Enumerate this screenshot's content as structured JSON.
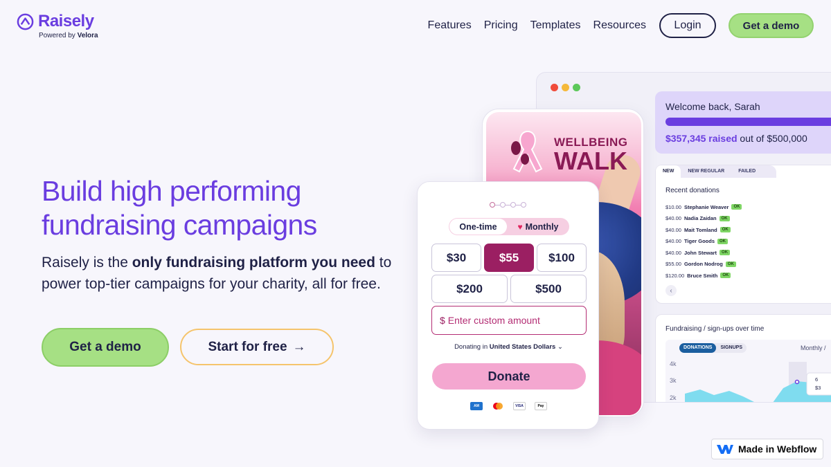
{
  "brand": {
    "name": "Raisely",
    "powered_prefix": "Powered by",
    "powered_by": "Velora",
    "color": "#6a3de0"
  },
  "nav": {
    "links": [
      "Features",
      "Pricing",
      "Templates",
      "Resources"
    ],
    "login": "Login",
    "demo": "Get a demo"
  },
  "hero": {
    "title": "Build high performing fundraising campaigns",
    "desc_pre": "Raisely is the ",
    "desc_bold": "only fundraising platform you need",
    "desc_post": " to power top-tier campaigns for your charity, all for free.",
    "cta_primary": "Get a demo",
    "cta_secondary": "Start for free",
    "cta_secondary_icon": "arrow-right-icon"
  },
  "dashboard": {
    "welcome": "Welcome back, Sarah",
    "raised_amount": "$357,345 raised",
    "raised_goal": " out of $500,000",
    "tabs": [
      "NEW",
      "NEW REGULAR",
      "FAILED"
    ],
    "recent_title": "Recent donations",
    "donations": [
      {
        "amount": "$10.00",
        "name": "Stephanie Weaver",
        "status": "OK"
      },
      {
        "amount": "$40.00",
        "name": "Nadia Zaidan",
        "status": "OK"
      },
      {
        "amount": "$40.00",
        "name": "Mait Tomland",
        "status": "OK"
      },
      {
        "amount": "$40.00",
        "name": "Tiger Goods",
        "status": "OK"
      },
      {
        "amount": "$40.00",
        "name": "John Stewart",
        "status": "OK"
      },
      {
        "amount": "$55.00",
        "name": "Gordon Nodrog",
        "status": "OK"
      },
      {
        "amount": "$120.00",
        "name": "Bruce Smith",
        "status": "OK"
      }
    ],
    "chart_title": "Fundraising / sign-ups over time",
    "chart_toggle": [
      "DONATIONS",
      "SIGNUPS"
    ],
    "chart_period": "Monthly /",
    "chart_yticks": [
      "4k",
      "3k",
      "2k"
    ],
    "tooltip_values": [
      "6",
      "$3"
    ]
  },
  "campaign": {
    "title_line1": "WELLBEING",
    "title_line2": "WALK"
  },
  "donate_form": {
    "freq_once": "One-time",
    "freq_monthly": "Monthly",
    "amounts_row1": [
      "$30",
      "$55",
      "$100"
    ],
    "amounts_row2": [
      "$200",
      "$500"
    ],
    "selected_amount": "$55",
    "custom_prefix": "$",
    "custom_placeholder": "Enter custom amount",
    "currency_prefix": "Donating in ",
    "currency": "United States Dollars",
    "donate_label": "Donate",
    "payment_icons": [
      "amex-icon",
      "mastercard-icon",
      "visa-icon",
      "apple-pay-icon"
    ]
  },
  "badge": {
    "label": "Made in Webflow"
  }
}
